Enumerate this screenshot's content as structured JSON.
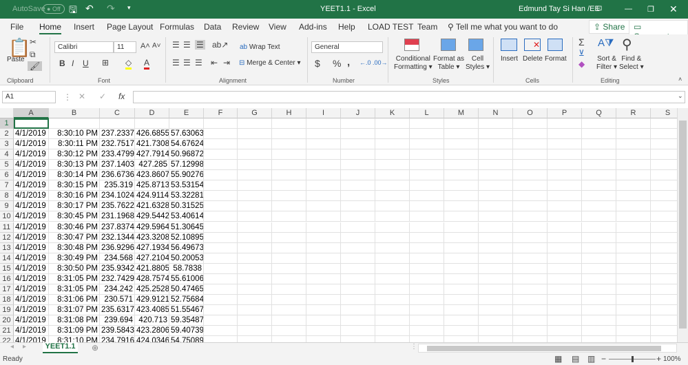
{
  "titlebar": {
    "autosave": "AutoSave",
    "autosave_state": "Off",
    "doc_title": "YEET1.1  -  Excel",
    "user": "Edmund Tay Si Han /EE"
  },
  "tabs": [
    "File",
    "Home",
    "Insert",
    "Page Layout",
    "Formulas",
    "Data",
    "Review",
    "View",
    "Add-ins",
    "Help",
    "LOAD TEST",
    "Team"
  ],
  "active_tab": "Home",
  "tell_me": "Tell me what you want to do",
  "share": "Share",
  "comments": "Comments",
  "ribbon": {
    "clipboard": {
      "paste": "Paste",
      "label": "Clipboard"
    },
    "font": {
      "name": "Calibri",
      "size": "11",
      "bold": "B",
      "italic": "I",
      "underline": "U",
      "label": "Font",
      "fill_color": "#ffff00",
      "font_color": "#e02020"
    },
    "alignment": {
      "wrap": "Wrap Text",
      "merge": "Merge & Center",
      "label": "Alignment"
    },
    "number": {
      "format": "General",
      "currency": "$",
      "percent": "%",
      "comma": ",",
      "label": "Number"
    },
    "styles": {
      "conditional": [
        "Conditional",
        "Formatting"
      ],
      "format_table": [
        "Format as",
        "Table"
      ],
      "cell_styles": [
        "Cell",
        "Styles"
      ],
      "label": "Styles"
    },
    "cells": {
      "insert": "Insert",
      "delete": "Delete",
      "format": "Format",
      "label": "Cells"
    },
    "editing": {
      "sort": [
        "Sort &",
        "Filter"
      ],
      "find": [
        "Find &",
        "Select"
      ],
      "label": "Editing"
    }
  },
  "formula_bar": {
    "name_box": "A1",
    "fx": "fx",
    "value": ""
  },
  "columns": [
    "A",
    "B",
    "C",
    "D",
    "E",
    "F",
    "G",
    "H",
    "I",
    "J",
    "K",
    "L",
    "M",
    "N",
    "O",
    "P",
    "Q",
    "R",
    "S"
  ],
  "rows": [
    [
      "",
      "",
      "",
      "",
      ""
    ],
    [
      "4/1/2019",
      "8:30:10 PM",
      "237.2337",
      "426.6855",
      "57.63063"
    ],
    [
      "4/1/2019",
      "8:30:11 PM",
      "232.7517",
      "421.7308",
      "54.67624"
    ],
    [
      "4/1/2019",
      "8:30:12 PM",
      "233.4799",
      "427.7914",
      "50.96872"
    ],
    [
      "4/1/2019",
      "8:30:13 PM",
      "237.1403",
      "427.285",
      "57.12998"
    ],
    [
      "4/1/2019",
      "8:30:14 PM",
      "236.6736",
      "423.8607",
      "55.90276"
    ],
    [
      "4/1/2019",
      "8:30:15 PM",
      "235.319",
      "425.8713",
      "53.53154"
    ],
    [
      "4/1/2019",
      "8:30:16 PM",
      "234.1024",
      "424.9114",
      "53.32281"
    ],
    [
      "4/1/2019",
      "8:30:17 PM",
      "235.7622",
      "421.6328",
      "50.31525"
    ],
    [
      "4/1/2019",
      "8:30:45 PM",
      "231.1968",
      "429.5442",
      "53.40614"
    ],
    [
      "4/1/2019",
      "8:30:46 PM",
      "237.8374",
      "429.5964",
      "51.30645"
    ],
    [
      "4/1/2019",
      "8:30:47 PM",
      "232.1344",
      "423.3208",
      "52.10895"
    ],
    [
      "4/1/2019",
      "8:30:48 PM",
      "236.9296",
      "427.1934",
      "56.49673"
    ],
    [
      "4/1/2019",
      "8:30:49 PM",
      "234.568",
      "427.2104",
      "50.20053"
    ],
    [
      "4/1/2019",
      "8:30:50 PM",
      "235.9342",
      "421.8805",
      "58.7838"
    ],
    [
      "4/1/2019",
      "8:31:05 PM",
      "232.7429",
      "428.7574",
      "55.61006"
    ],
    [
      "4/1/2019",
      "8:31:05 PM",
      "234.242",
      "425.2528",
      "50.47465"
    ],
    [
      "4/1/2019",
      "8:31:06 PM",
      "230.571",
      "429.9121",
      "52.75684"
    ],
    [
      "4/1/2019",
      "8:31:07 PM",
      "235.6317",
      "423.4085",
      "51.55467"
    ],
    [
      "4/1/2019",
      "8:31:08 PM",
      "239.694",
      "420.713",
      "59.35487"
    ],
    [
      "4/1/2019",
      "8:31:09 PM",
      "239.5843",
      "423.2806",
      "59.40739"
    ],
    [
      "4/1/2019",
      "8:31:10 PM",
      "234.7916",
      "424.0346",
      "54.75089"
    ]
  ],
  "sheet_tab": "YEET1.1",
  "status": {
    "text": "Ready",
    "zoom": "100%",
    "zoom_percent": 100
  }
}
